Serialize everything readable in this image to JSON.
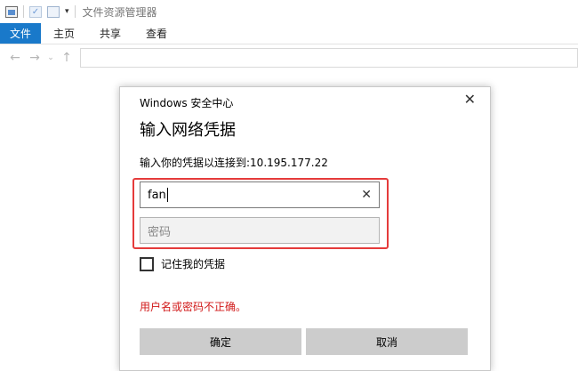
{
  "window": {
    "title": "文件资源管理器"
  },
  "quick_access": {
    "icons": [
      "folder-icon",
      "check-icon",
      "page-icon",
      "dropdown-icon"
    ],
    "dropdown": "▾"
  },
  "ribbon": {
    "tabs": [
      "文件",
      "主页",
      "共享",
      "查看"
    ],
    "active_color": "#1979ca"
  },
  "nav": {
    "back": "←",
    "forward": "→",
    "recent": "⌄",
    "up": "↑",
    "address": ""
  },
  "dialog": {
    "caption": "Windows 安全中心",
    "close": "✕",
    "title": "输入网络凭据",
    "prompt": "输入你的凭据以连接到:10.195.177.22",
    "username": {
      "value": "fan"
    },
    "clear": "✕",
    "password": {
      "value": "",
      "placeholder": "密码"
    },
    "remember_label": "记住我的凭据",
    "remember_checked": false,
    "error": "用户名或密码不正确。",
    "ok_label": "确定",
    "cancel_label": "取消",
    "highlight_color": "#e53b3b",
    "error_color": "#d11a1a"
  }
}
